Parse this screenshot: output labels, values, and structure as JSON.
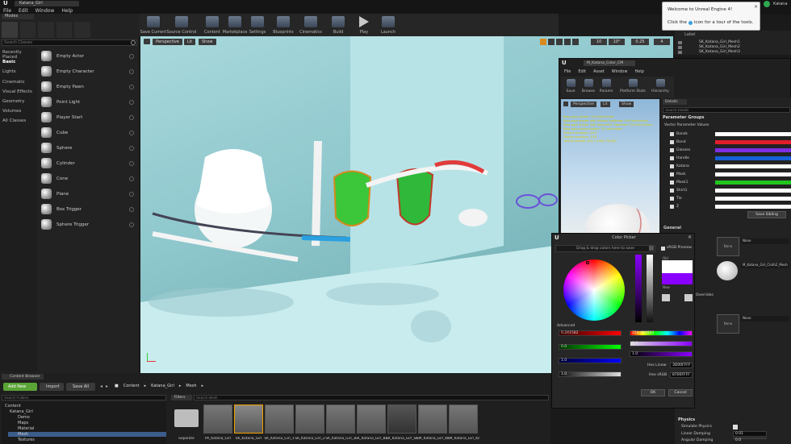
{
  "window": {
    "tab_title": "Katana_Girl",
    "menu": [
      "File",
      "Edit",
      "Window",
      "Help"
    ],
    "user": "Katana"
  },
  "modes": {
    "title": "Modes",
    "search_placeholder": "Search Classes",
    "categories": [
      "Recently Placed",
      "Basic",
      "Lights",
      "Cinematic",
      "Visual Effects",
      "Geometry",
      "Volumes",
      "All Classes"
    ],
    "items": [
      "Empty Actor",
      "Empty Character",
      "Empty Pawn",
      "Point Light",
      "Player Start",
      "Cube",
      "Sphere",
      "Cylinder",
      "Cone",
      "Plane",
      "Box Trigger",
      "Sphere Trigger"
    ]
  },
  "toolbar": {
    "buttons": [
      "Save Current",
      "Source Control",
      "Content",
      "Marketplace",
      "Settings",
      "Blueprints",
      "Cinematics",
      "Build",
      "Play",
      "Launch"
    ]
  },
  "viewport": {
    "perspective": "Perspective",
    "lit": "Lit",
    "show": "Show",
    "snap_values": [
      "10",
      "10°",
      "0.25",
      "4"
    ]
  },
  "tooltip": {
    "title": "Welcome to Unreal Engine 4!",
    "body_before": "Click the",
    "body_after": "icon for a tour of the tools."
  },
  "outliner": {
    "header": "Label",
    "rows": [
      "SK_Katana_Girl_Mesh1",
      "SK_Katana_Girl_Mesh2",
      "SK_Katana_Girl_Mesh3"
    ]
  },
  "material_editor": {
    "tab": "M_Katana_Color_CM",
    "menu": [
      "File",
      "Edit",
      "Asset",
      "Window",
      "Help"
    ],
    "tools": [
      "Save",
      "Browse",
      "Params",
      "Platform Stats",
      "Hierarchy"
    ],
    "perspective": "Perspective",
    "lit": "Lit",
    "show": "Show",
    "stats": [
      "Base pass shader: 134 instructions",
      "Base pass shader with Surface Lightmap: 159 instructions",
      "Base pass shader with Volumetric Lightmap: 154 instructions",
      "Base pass vertex shader: 32 instructions",
      "Texture samplers: 2/16",
      "Texture samplers: 1/16",
      "Texture lookups (Est.): 0/0/0, PS(0/0)"
    ]
  },
  "details": {
    "tab": "Details",
    "search_placeholder": "Search Details",
    "param_groups": "Parameter Groups",
    "vector_values": "Vector Parameter Values",
    "params": [
      {
        "name": "Bands",
        "color": "#ffffff"
      },
      {
        "name": "Bond",
        "color": "#e11d2b"
      },
      {
        "name": "Glasses",
        "color": "#7b2fe0"
      },
      {
        "name": "Handle",
        "color": "#1560d8"
      },
      {
        "name": "Katana",
        "color": "#ffffff"
      },
      {
        "name": "Mask",
        "color": "#ffffff"
      },
      {
        "name": "Mask1",
        "color": "#22c41e"
      },
      {
        "name": "Shirt1",
        "color": "#ffffff"
      },
      {
        "name": "Tie",
        "color": "#ffffff"
      },
      {
        "name": "Z",
        "color": "#ffffff"
      }
    ],
    "save_sibling": "Save Sibling",
    "general": "General"
  },
  "right_lower": {
    "slot1": "None",
    "slot2": "M_Katana_Girl_Cloth2_Mesh",
    "overrides": "Overrides",
    "slot3": "None",
    "physics": "Physics",
    "rows": [
      {
        "label": "Simulate Physics",
        "value": ""
      },
      {
        "label": "Linear Damping",
        "value": "0.01"
      },
      {
        "label": "Angular Damping",
        "value": "0.0"
      }
    ]
  },
  "color_picker": {
    "title": "Color Picker",
    "drop_hint": "Drag & drop colors here to save",
    "srgb_preview": "sRGB Preview",
    "old": "Old",
    "new": "New",
    "advanced": "Advanced",
    "fields_left": [
      "0.241582",
      "0.0",
      "1.0",
      "1.0"
    ],
    "fields_right": [
      "254.494934",
      "1.0",
      "1.0"
    ],
    "hex_linear_label": "Hex Linear",
    "hex_linear": "3D00FFFF",
    "hex_srgb_label": "Hex sRGB",
    "hex_srgb": "8700FFFF",
    "ok": "OK",
    "cancel": "Cancel",
    "new_color": "#8a00ff"
  },
  "content_browser": {
    "tab": "Content Browser",
    "add_new": "Add New",
    "import": "Import",
    "save_all": "Save All",
    "path": [
      "Content",
      "Katana_Girl",
      "Mesh"
    ],
    "search_folders": "Search Folders",
    "filters": "Filters",
    "search_mesh": "Search Mesh",
    "tree": [
      "Content",
      "Katana_Girl",
      "Demo",
      "Maps",
      "Material",
      "Mesh",
      "Textures"
    ],
    "assets": [
      "Separate",
      "PA_Katana_Girl",
      "SK_Katana_Girl",
      "SK_Katana_Girl_1",
      "SK_Katana_Girl_2",
      "SK_Katana_Girl_3",
      "SK_Katana_Girl_Body",
      "SK_Katana_Girl_Skeleton",
      "SM_Katana_Girl_Katana",
      "SM_Katana_Girl_Katana1"
    ]
  }
}
